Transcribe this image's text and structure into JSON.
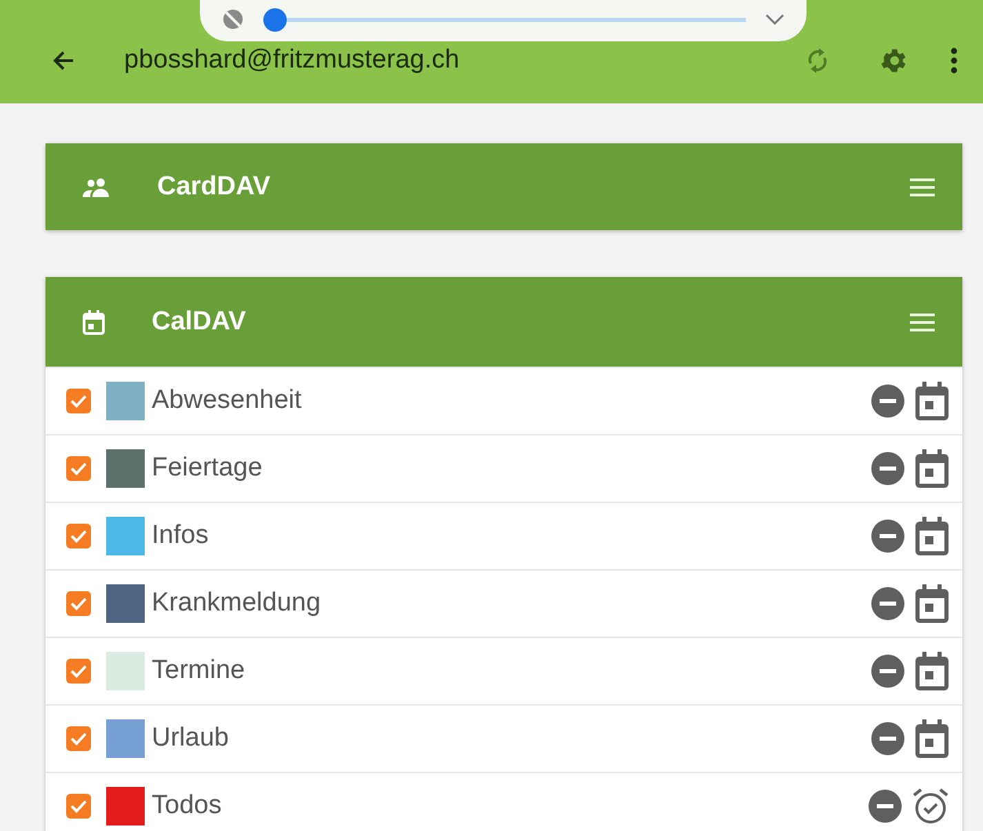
{
  "overlay_slider": {
    "level": 0.0
  },
  "app_bar": {
    "title": "pbosshard@fritzmusterag.ch"
  },
  "cards": [
    {
      "kind": "contacts",
      "title": "CardDAV"
    },
    {
      "kind": "calendar",
      "title": "CalDAV",
      "items": [
        {
          "name": "Abwesenheit",
          "color": "#7fb0c4",
          "checked": true,
          "kind": "calendar"
        },
        {
          "name": "Feiertage",
          "color": "#5a716c",
          "checked": true,
          "kind": "calendar"
        },
        {
          "name": "Infos",
          "color": "#4bb8e8",
          "checked": true,
          "kind": "calendar"
        },
        {
          "name": "Krankmeldung",
          "color": "#4f6483",
          "checked": true,
          "kind": "calendar"
        },
        {
          "name": "Termine",
          "color": "#dcebe2",
          "checked": true,
          "kind": "calendar"
        },
        {
          "name": "Urlaub",
          "color": "#769fd3",
          "checked": true,
          "kind": "calendar"
        },
        {
          "name": "Todos",
          "color": "#e21b1b",
          "checked": true,
          "kind": "tasks"
        }
      ]
    }
  ]
}
